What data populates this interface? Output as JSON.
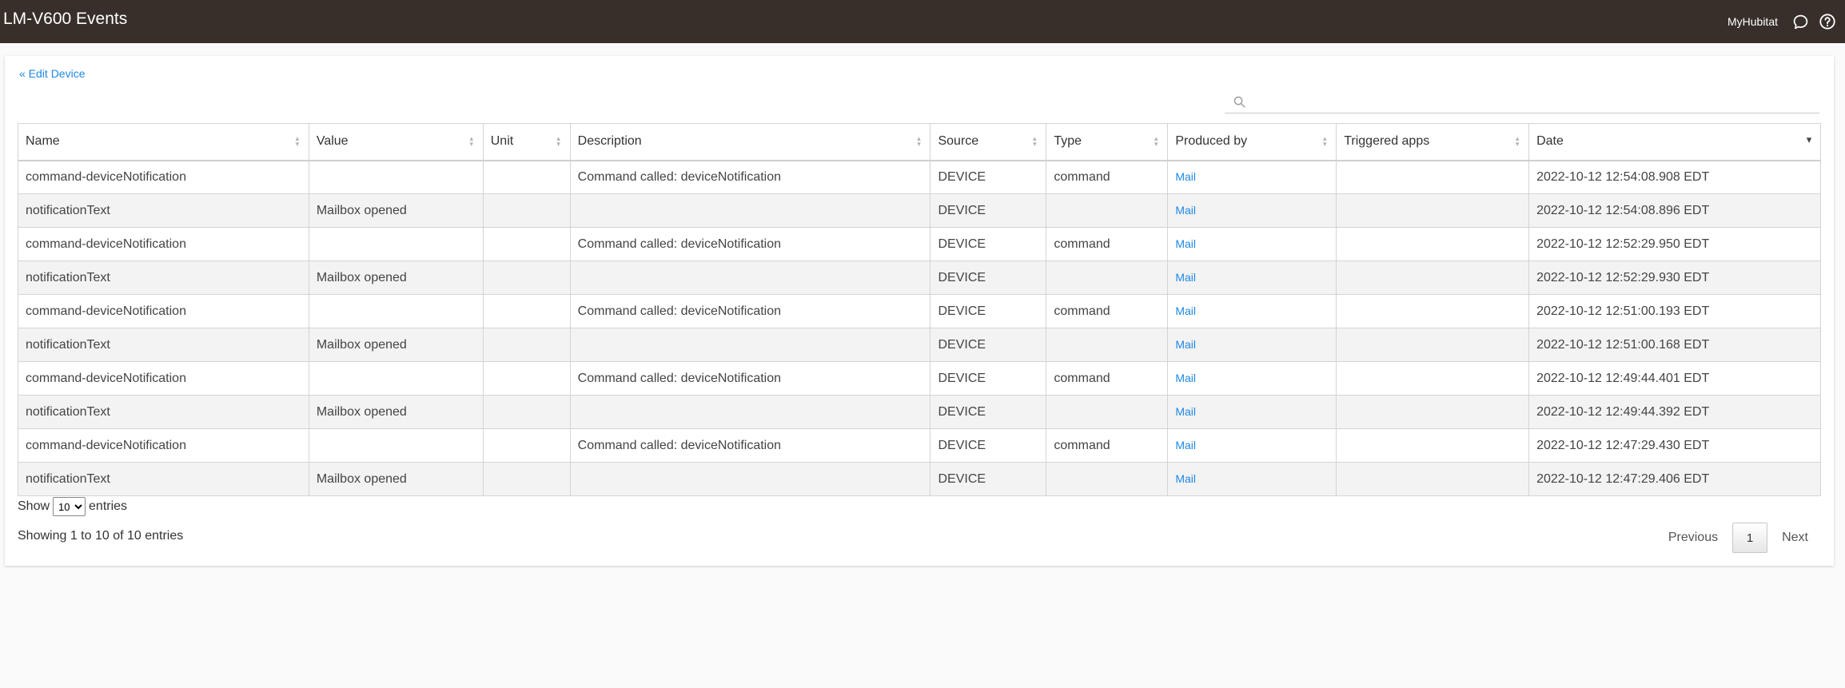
{
  "header": {
    "title": "LM-V600 Events",
    "hub_name": "MyHubitat"
  },
  "back_link": "« Edit Device",
  "search": {
    "value": "",
    "placeholder": ""
  },
  "table": {
    "columns": [
      "Name",
      "Value",
      "Unit",
      "Description",
      "Source",
      "Type",
      "Produced by",
      "Triggered apps",
      "Date"
    ],
    "sorted_column": "Date",
    "sort_direction": "descending",
    "rows": [
      {
        "name": "command-deviceNotification",
        "value": "",
        "unit": "",
        "description": "Command called: deviceNotification",
        "source": "DEVICE",
        "type": "command",
        "produced_by": "Mail",
        "triggered_apps": "",
        "date": "2022-10-12 12:54:08.908 EDT"
      },
      {
        "name": "notificationText",
        "value": "Mailbox opened",
        "unit": "",
        "description": "",
        "source": "DEVICE",
        "type": "",
        "produced_by": "Mail",
        "triggered_apps": "",
        "date": "2022-10-12 12:54:08.896 EDT"
      },
      {
        "name": "command-deviceNotification",
        "value": "",
        "unit": "",
        "description": "Command called: deviceNotification",
        "source": "DEVICE",
        "type": "command",
        "produced_by": "Mail",
        "triggered_apps": "",
        "date": "2022-10-12 12:52:29.950 EDT"
      },
      {
        "name": "notificationText",
        "value": "Mailbox opened",
        "unit": "",
        "description": "",
        "source": "DEVICE",
        "type": "",
        "produced_by": "Mail",
        "triggered_apps": "",
        "date": "2022-10-12 12:52:29.930 EDT"
      },
      {
        "name": "command-deviceNotification",
        "value": "",
        "unit": "",
        "description": "Command called: deviceNotification",
        "source": "DEVICE",
        "type": "command",
        "produced_by": "Mail",
        "triggered_apps": "",
        "date": "2022-10-12 12:51:00.193 EDT"
      },
      {
        "name": "notificationText",
        "value": "Mailbox opened",
        "unit": "",
        "description": "",
        "source": "DEVICE",
        "type": "",
        "produced_by": "Mail",
        "triggered_apps": "",
        "date": "2022-10-12 12:51:00.168 EDT"
      },
      {
        "name": "command-deviceNotification",
        "value": "",
        "unit": "",
        "description": "Command called: deviceNotification",
        "source": "DEVICE",
        "type": "command",
        "produced_by": "Mail",
        "triggered_apps": "",
        "date": "2022-10-12 12:49:44.401 EDT"
      },
      {
        "name": "notificationText",
        "value": "Mailbox opened",
        "unit": "",
        "description": "",
        "source": "DEVICE",
        "type": "",
        "produced_by": "Mail",
        "triggered_apps": "",
        "date": "2022-10-12 12:49:44.392 EDT"
      },
      {
        "name": "command-deviceNotification",
        "value": "",
        "unit": "",
        "description": "Command called: deviceNotification",
        "source": "DEVICE",
        "type": "command",
        "produced_by": "Mail",
        "triggered_apps": "",
        "date": "2022-10-12 12:47:29.430 EDT"
      },
      {
        "name": "notificationText",
        "value": "Mailbox opened",
        "unit": "",
        "description": "",
        "source": "DEVICE",
        "type": "",
        "produced_by": "Mail",
        "triggered_apps": "",
        "date": "2022-10-12 12:47:29.406 EDT"
      }
    ]
  },
  "length_menu": {
    "prefix": "Show",
    "selected": "10",
    "suffix": "entries"
  },
  "info": "Showing 1 to 10 of 10 entries",
  "pagination": {
    "previous": "Previous",
    "current": "1",
    "next": "Next"
  },
  "icons": {
    "chat": "chat-bubble-icon",
    "help": "help-circle-icon",
    "search": "search-icon"
  },
  "colors": {
    "header_bg": "#382f2b",
    "link": "#1e88e5"
  }
}
